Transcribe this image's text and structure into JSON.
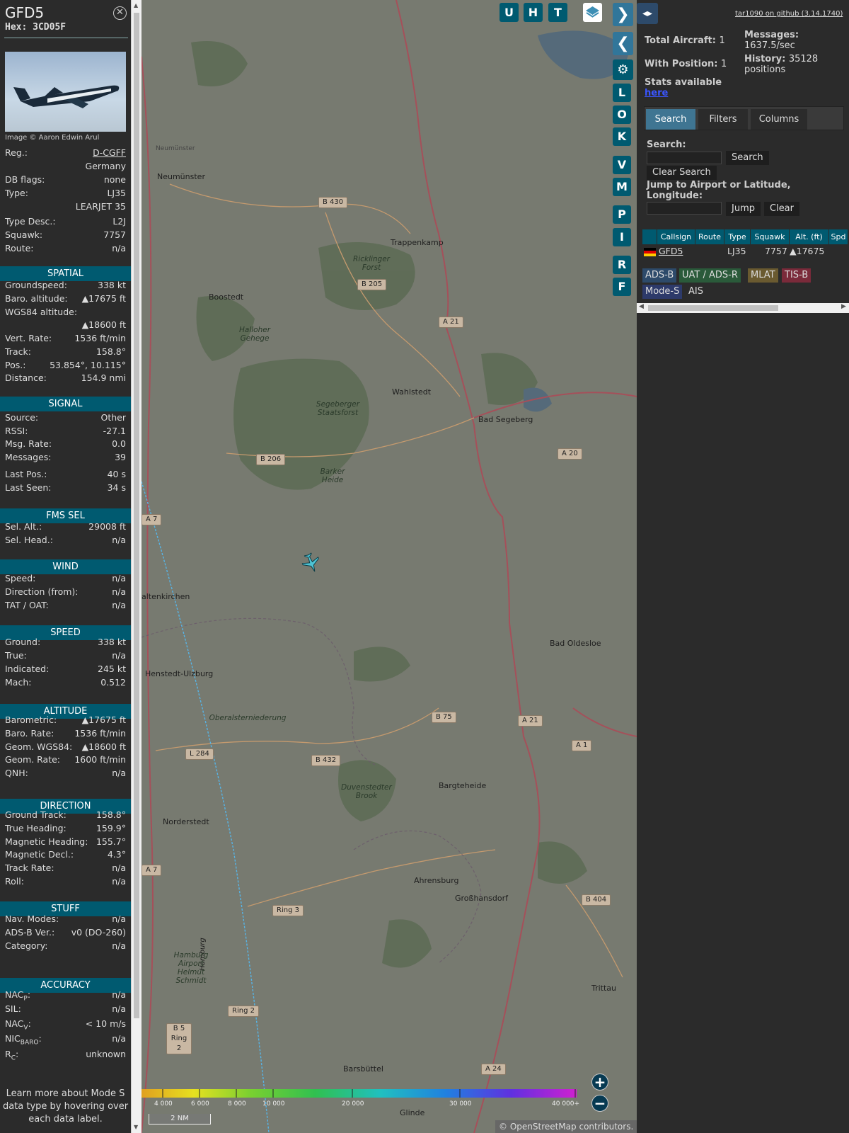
{
  "aircraft": {
    "callsign": "GFD5",
    "hex_label": "Hex: 3CD05F",
    "photo_credit": "Image © Aaron Edwin Arul"
  },
  "info": [
    {
      "label": "Reg.:",
      "value": "D-CGFF",
      "link": true
    },
    {
      "label": "",
      "value": "Germany"
    },
    {
      "label": "DB flags:",
      "value": "none"
    },
    {
      "label": "Type:",
      "value": "LJ35"
    },
    {
      "label": "",
      "value": "LEARJET 35"
    },
    {
      "label": "Type Desc.:",
      "value": "L2J"
    },
    {
      "label": "Squawk:",
      "value": "7757"
    },
    {
      "label": "Route:",
      "value": "n/a"
    }
  ],
  "sections": {
    "spatial": "SPATIAL",
    "signal": "SIGNAL",
    "fms": "FMS SEL",
    "wind": "WIND",
    "speed": "SPEED",
    "altitude": "ALTITUDE",
    "direction": "DIRECTION",
    "stuff": "STUFF",
    "accuracy": "ACCURACY"
  },
  "spatial": [
    {
      "label": "Groundspeed:",
      "value": "338 kt"
    },
    {
      "label": "Baro. altitude:",
      "value": "▲17675 ft"
    },
    {
      "label": "WGS84 altitude:",
      "value": ""
    },
    {
      "label": "",
      "value": "▲18600 ft"
    },
    {
      "label": "Vert. Rate:",
      "value": "1536 ft/min"
    },
    {
      "label": "Track:",
      "value": "158.8°"
    },
    {
      "label": "Pos.:",
      "value": "53.854°, 10.115°"
    },
    {
      "label": "Distance:",
      "value": "154.9 nmi"
    }
  ],
  "signal": [
    {
      "label": "Source:",
      "value": "Other"
    },
    {
      "label": "RSSI:",
      "value": "-27.1"
    },
    {
      "label": "Msg. Rate:",
      "value": "0.0"
    },
    {
      "label": "Messages:",
      "value": "39"
    },
    {
      "label": "Last Pos.:",
      "value": "40 s"
    },
    {
      "label": "Last Seen:",
      "value": "34 s"
    }
  ],
  "fms": [
    {
      "label": "Sel. Alt.:",
      "value": "29008 ft"
    },
    {
      "label": "Sel. Head.:",
      "value": "n/a"
    }
  ],
  "wind": [
    {
      "label": "Speed:",
      "value": "n/a"
    },
    {
      "label": "Direction (from):",
      "value": "n/a"
    },
    {
      "label": "TAT / OAT:",
      "value": "n/a"
    }
  ],
  "speed": [
    {
      "label": "Ground:",
      "value": "338 kt"
    },
    {
      "label": "True:",
      "value": "n/a"
    },
    {
      "label": "Indicated:",
      "value": "245 kt"
    },
    {
      "label": "Mach:",
      "value": "0.512"
    }
  ],
  "altitude": [
    {
      "label": "Barometric:",
      "value": "▲17675 ft"
    },
    {
      "label": "Baro. Rate:",
      "value": "1536 ft/min"
    },
    {
      "label": "Geom. WGS84:",
      "value": "▲18600 ft"
    },
    {
      "label": "Geom. Rate:",
      "value": "1600 ft/min"
    },
    {
      "label": "QNH:",
      "value": "n/a"
    }
  ],
  "direction": [
    {
      "label": "Ground Track:",
      "value": "158.8°"
    },
    {
      "label": "True Heading:",
      "value": "159.9°"
    },
    {
      "label": "Magnetic Heading:",
      "value": "155.7°"
    },
    {
      "label": "Magnetic Decl.:",
      "value": "4.3°"
    },
    {
      "label": "Track Rate:",
      "value": "n/a"
    },
    {
      "label": "Roll:",
      "value": "n/a"
    }
  ],
  "stuff": [
    {
      "label": "Nav. Modes:",
      "value": "n/a"
    },
    {
      "label": "ADS-B Ver.:",
      "value": "v0 (DO-260)"
    },
    {
      "label": "Category:",
      "value": "n/a"
    }
  ],
  "accuracy": [
    {
      "label": "NAC",
      "sub": "P",
      "value": "n/a"
    },
    {
      "label": "SIL:",
      "sub": "",
      "value": "n/a"
    },
    {
      "label": "NAC",
      "sub": "V",
      "value": "< 10 m/s"
    },
    {
      "label": "NIC",
      "sub": "BARO",
      "value": "n/a"
    },
    {
      "label": "R",
      "sub": "C",
      "value": "unknown"
    }
  ],
  "learn_more": "Learn more about Mode S data type by hovering over each data label.",
  "map": {
    "top_buttons": [
      "U",
      "H",
      "T"
    ],
    "side_buttons": [
      "L",
      "O",
      "K",
      "V",
      "M",
      "P",
      "I",
      "R",
      "F"
    ],
    "towns": [
      {
        "name": "Neumünster"
      },
      {
        "name": "Trappenkamp"
      },
      {
        "name": "Boostedt"
      },
      {
        "name": "Wahlstedt"
      },
      {
        "name": "Bad Segeberg"
      },
      {
        "name": "altenkirchen"
      },
      {
        "name": "Henstedt-Ulzburg"
      },
      {
        "name": "Bad Oldesloe"
      },
      {
        "name": "Bargteheide"
      },
      {
        "name": "Norderstedt"
      },
      {
        "name": "Ahrensburg"
      },
      {
        "name": "Großhansdorf"
      },
      {
        "name": "Trittau"
      },
      {
        "name": "Barsbüttel"
      },
      {
        "name": "Glinde"
      },
      {
        "name": "Hamburg"
      },
      {
        "name": "Neumünster"
      }
    ],
    "areas": [
      {
        "name": "Ricklinger Forst"
      },
      {
        "name": "Halloher Gehege"
      },
      {
        "name": "Segeberger Staatsforst"
      },
      {
        "name": "Barker Heide"
      },
      {
        "name": "Oberalsterniederung"
      },
      {
        "name": "Duvenstedter Brook"
      },
      {
        "name": "Hamburg Airport Helmut Schmidt"
      }
    ],
    "roads": [
      "B 430",
      "B 205",
      "A 21",
      "B 206",
      "A 20",
      "A 7",
      "B 75",
      "A 21",
      "A 1",
      "L 284",
      "B 432",
      "A 7",
      "Ring 3",
      "B 404",
      "Ring 2",
      "B 5 Ring 2",
      "A 24"
    ],
    "colorbar_labels": [
      "4 000",
      "6 000",
      "8 000",
      "10 000",
      "20 000",
      "30 000",
      "40 000+"
    ],
    "scale": "2 NM",
    "attribution": "© OpenStreetMap contributors."
  },
  "right": {
    "github": "tar1090 on github (3.14.1740)",
    "total_aircraft_label": "Total Aircraft:",
    "total_aircraft": "1",
    "with_position_label": "With Position:",
    "with_position": "1",
    "messages_label": "Messages:",
    "messages": "1637.5/sec",
    "history_label": "History:",
    "history": "35128 positions",
    "stats_label": "Stats available",
    "stats_link": "here",
    "tabs": [
      "Search",
      "Filters",
      "Columns"
    ],
    "search_label": "Search:",
    "search_btn": "Search",
    "clear_search_btn": "Clear Search",
    "jump_label": "Jump to Airport or Latitude, Longitude:",
    "jump_btn": "Jump",
    "clear_btn": "Clear",
    "columns": [
      "",
      "Callsign",
      "Route",
      "Type",
      "Squawk",
      "Alt. (ft)",
      "Spd"
    ],
    "row": {
      "callsign": "GFD5",
      "route": "",
      "type": "LJ35",
      "squawk": "7757",
      "alt": "▲17675"
    },
    "sources": [
      "ADS-B",
      "UAT / ADS-R",
      "MLAT",
      "TIS-B",
      "Mode-S",
      "AIS"
    ]
  }
}
